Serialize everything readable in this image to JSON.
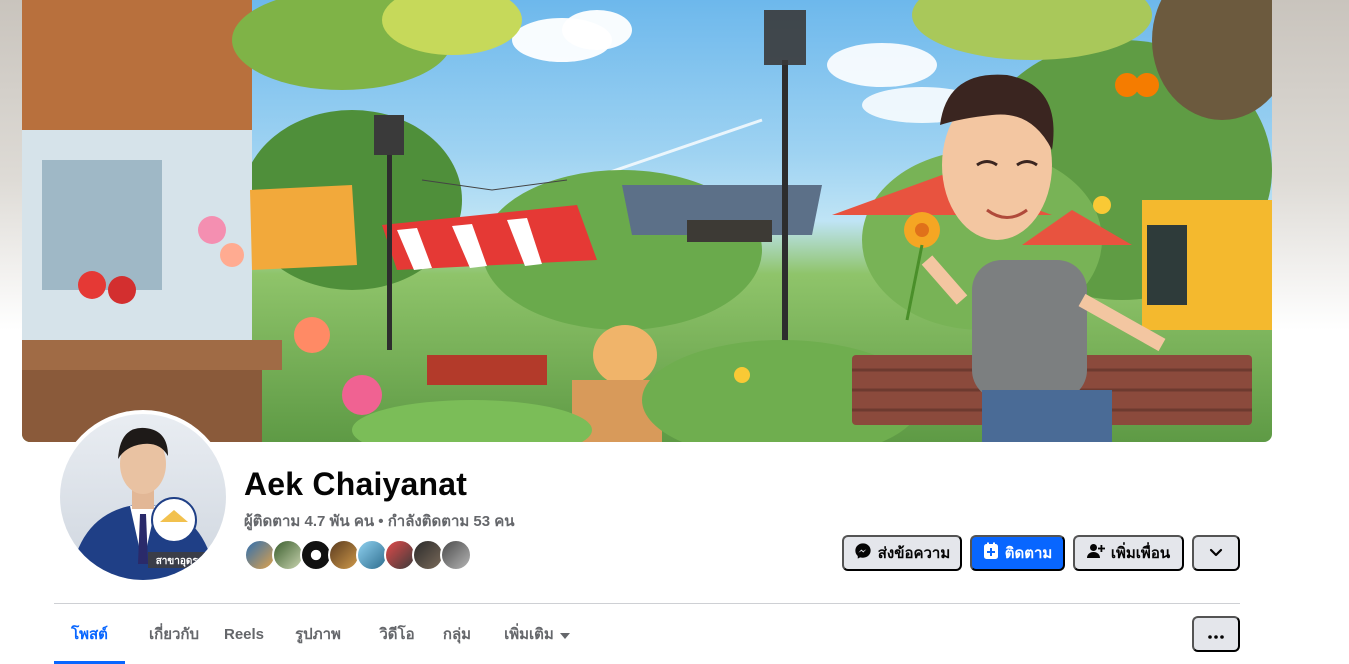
{
  "profile": {
    "name": "Aek Chaiyanat",
    "stats": "ผู้ติดตาม 4.7 พัน คน • กำลังติดตาม 53 คน",
    "avatar_badge_text": "สาขาอุดรธานี"
  },
  "actions": {
    "message_label": "ส่งข้อความ",
    "follow_label": "ติดตาม",
    "add_friend_label": "เพิ่มเพื่อน"
  },
  "tabs": [
    {
      "label": "โพสต์",
      "active": true
    },
    {
      "label": "เกี่ยวกับ",
      "active": false
    },
    {
      "label": "Reels",
      "active": false
    },
    {
      "label": "รูปภาพ",
      "active": false
    },
    {
      "label": "วิดีโอ",
      "active": false
    },
    {
      "label": "กลุ่ม",
      "active": false
    },
    {
      "label": "เพิ่มเติม",
      "active": false
    }
  ],
  "colors": {
    "accent": "#0866ff",
    "button_gray": "#e4e6eb",
    "text_secondary": "#65676b"
  },
  "icons": {
    "message": "messenger-icon",
    "follow": "follow-plus-icon",
    "add_friend": "add-friend-icon",
    "dropdown": "chevron-down-icon",
    "menu": "more-dots-icon"
  }
}
